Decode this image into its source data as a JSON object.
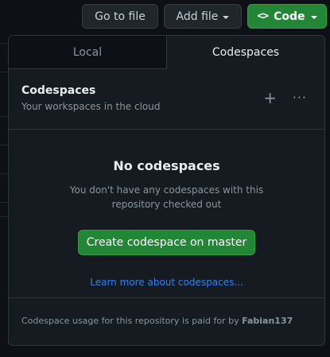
{
  "toolbar": {
    "go_to_file": "Go to file",
    "add_file": "Add file",
    "code": "Code"
  },
  "tabs": [
    {
      "label": "Local",
      "active": false
    },
    {
      "label": "Codespaces",
      "active": true
    }
  ],
  "codespaces": {
    "title": "Codespaces",
    "subtitle": "Your workspaces in the cloud",
    "empty_title": "No codespaces",
    "empty_desc_line1": "You don't have any codespaces with this",
    "empty_desc_line2": "repository checked out",
    "create_label": "Create codespace on master",
    "learn_more": "Learn more about codespaces...",
    "footer_text": "Codespace usage for this repository is paid for by",
    "footer_user": "Fabian137"
  },
  "colors": {
    "background": "#0d1117",
    "panel": "#161b22",
    "accent_green": "#238636",
    "link_blue": "#2f81f7"
  },
  "icons": {
    "code": "code-brackets-icon",
    "plus": "plus-icon",
    "more": "kebab-horizontal-icon",
    "caret": "triangle-down-icon"
  }
}
